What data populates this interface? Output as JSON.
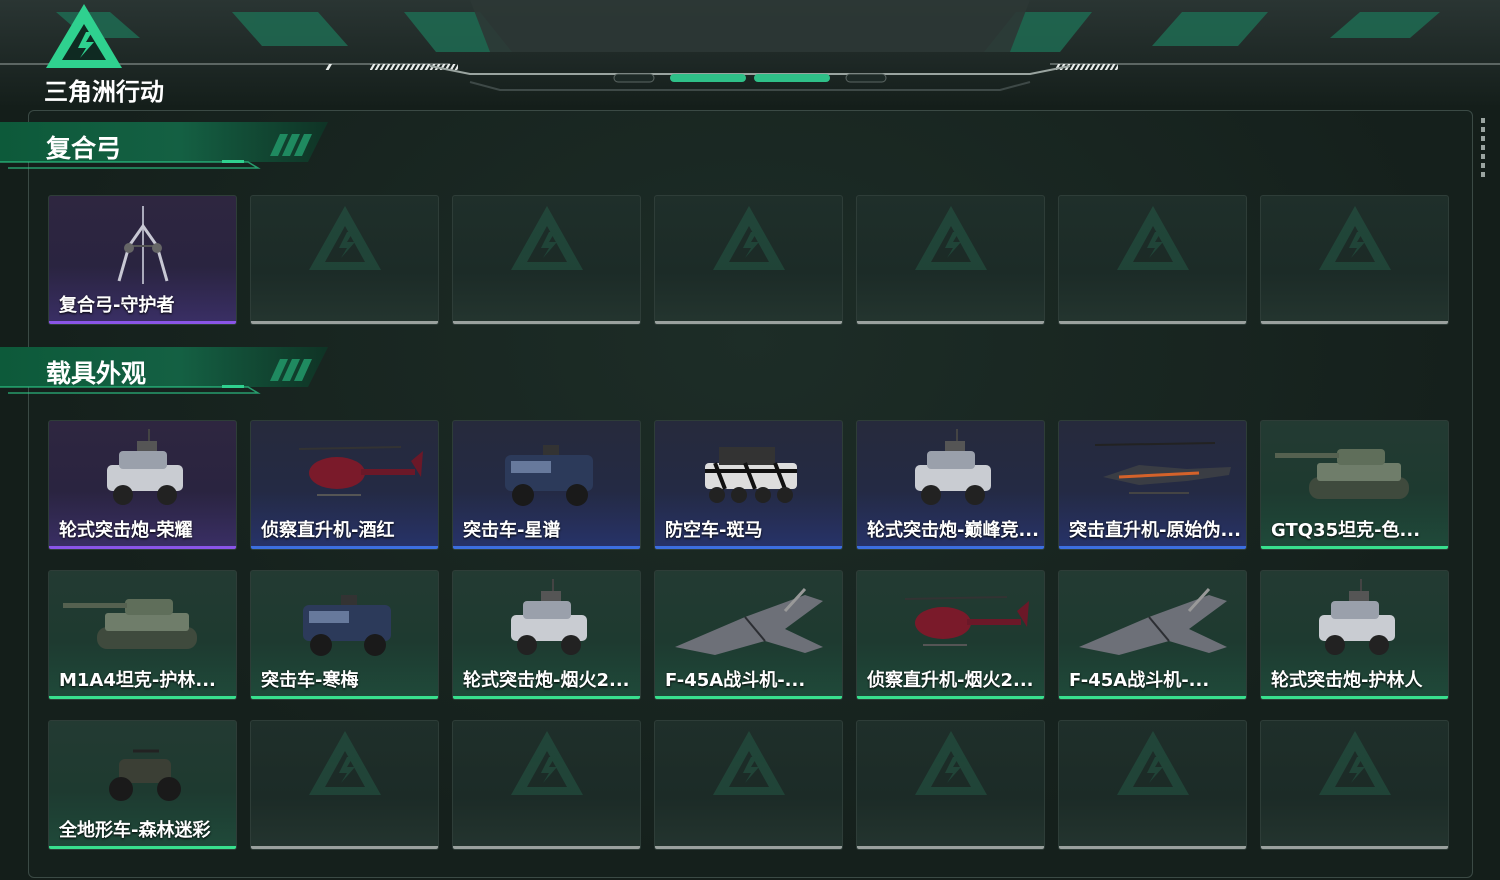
{
  "app": {
    "logo_text": "三角洲行动"
  },
  "sections": [
    {
      "title": "复合弓",
      "items": [
        {
          "label": "复合弓-守护者",
          "rarity": "purple",
          "icon": "compound-bow-icon"
        },
        {
          "label": "",
          "rarity": "empty"
        },
        {
          "label": "",
          "rarity": "empty"
        },
        {
          "label": "",
          "rarity": "empty"
        },
        {
          "label": "",
          "rarity": "empty"
        },
        {
          "label": "",
          "rarity": "empty"
        },
        {
          "label": "",
          "rarity": "empty"
        }
      ]
    },
    {
      "title": "载具外观",
      "items": [
        {
          "label": "轮式突击炮-荣耀",
          "rarity": "purple",
          "icon": "armored-car-icon"
        },
        {
          "label": "侦察直升机-酒红",
          "rarity": "blue",
          "icon": "helicopter-icon"
        },
        {
          "label": "突击车-星谱",
          "rarity": "blue",
          "icon": "assault-truck-icon"
        },
        {
          "label": "防空车-斑马",
          "rarity": "blue",
          "icon": "aa-vehicle-icon"
        },
        {
          "label": "轮式突击炮-巅峰竞...",
          "rarity": "blue",
          "icon": "armored-car-icon"
        },
        {
          "label": "突击直升机-原始伪...",
          "rarity": "blue",
          "icon": "attack-helicopter-icon"
        },
        {
          "label": "GTQ35坦克-色...",
          "rarity": "green",
          "icon": "tank-icon"
        },
        {
          "label": "M1A4坦克-护林...",
          "rarity": "green",
          "icon": "tank-icon"
        },
        {
          "label": "突击车-寒梅",
          "rarity": "green",
          "icon": "assault-truck-icon"
        },
        {
          "label": "轮式突击炮-烟火2...",
          "rarity": "green",
          "icon": "armored-car-icon"
        },
        {
          "label": "F-45A战斗机-...",
          "rarity": "green",
          "icon": "fighter-jet-icon"
        },
        {
          "label": "侦察直升机-烟火2...",
          "rarity": "green",
          "icon": "helicopter-icon"
        },
        {
          "label": "F-45A战斗机-...",
          "rarity": "green",
          "icon": "fighter-jet-icon"
        },
        {
          "label": "轮式突击炮-护林人",
          "rarity": "green",
          "icon": "armored-car-icon"
        },
        {
          "label": "全地形车-森林迷彩",
          "rarity": "green",
          "icon": "atv-icon"
        },
        {
          "label": "",
          "rarity": "empty"
        },
        {
          "label": "",
          "rarity": "empty"
        },
        {
          "label": "",
          "rarity": "empty"
        },
        {
          "label": "",
          "rarity": "empty"
        },
        {
          "label": "",
          "rarity": "empty"
        },
        {
          "label": "",
          "rarity": "empty"
        }
      ]
    }
  ]
}
